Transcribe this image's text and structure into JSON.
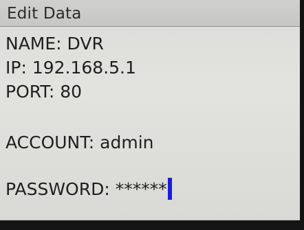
{
  "window": {
    "title": "Edit Data"
  },
  "form": {
    "name_label": "NAME:",
    "name_value": "DVR",
    "ip_label": "IP:",
    "ip_value": "192.168.5.1",
    "port_label": "PORT:",
    "port_value": "80",
    "account_label": "ACCOUNT:",
    "account_value": "admin",
    "password_label": "PASSWORD:",
    "password_value": "******"
  },
  "colors": {
    "screen_background": "#dedede",
    "title_bar": "#cacaca",
    "text": "#1f1f1f",
    "cursor": "#1b1bd8"
  }
}
